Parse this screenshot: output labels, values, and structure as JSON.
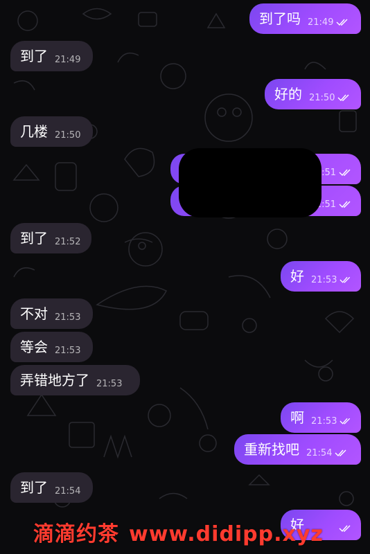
{
  "theme": {
    "background": "#0b0b0d",
    "incoming_bubble": "#2a2530",
    "outgoing_bubble": "#8f4cff",
    "read_tick_color": "#ffffff",
    "watermark_color": "#ff3b2f"
  },
  "messages": [
    {
      "side": "outgoing",
      "text": "到了吗",
      "time": "21:49",
      "read": true
    },
    {
      "side": "incoming",
      "text": "到了",
      "time": "21:49"
    },
    {
      "side": "outgoing",
      "text": "好的",
      "time": "21:50",
      "read": true
    },
    {
      "side": "incoming",
      "text": "几楼",
      "time": "21:50"
    },
    {
      "side": "outgoing",
      "text": "",
      "time": "21:51",
      "read": true,
      "redacted": true
    },
    {
      "side": "outgoing",
      "text": "",
      "time": "21:51",
      "read": true,
      "redacted": true
    },
    {
      "side": "incoming",
      "text": "到了",
      "time": "21:52"
    },
    {
      "side": "outgoing",
      "text": "好",
      "time": "21:53",
      "read": true
    },
    {
      "side": "incoming",
      "text": "不对",
      "time": "21:53"
    },
    {
      "side": "incoming",
      "text": "等会",
      "time": "21:53"
    },
    {
      "side": "incoming",
      "text": "弄错地方了",
      "time": "21:53"
    },
    {
      "side": "outgoing",
      "text": "啊",
      "time": "21:53",
      "read": true
    },
    {
      "side": "outgoing",
      "text": "重新找吧",
      "time": "21:54",
      "read": true
    },
    {
      "side": "incoming",
      "text": "到了",
      "time": "21:54"
    },
    {
      "side": "outgoing",
      "text": "好",
      "time": "",
      "read": true
    }
  ],
  "watermark": {
    "cn": "滴滴约茶",
    "url": "www.didipp.xyz"
  }
}
